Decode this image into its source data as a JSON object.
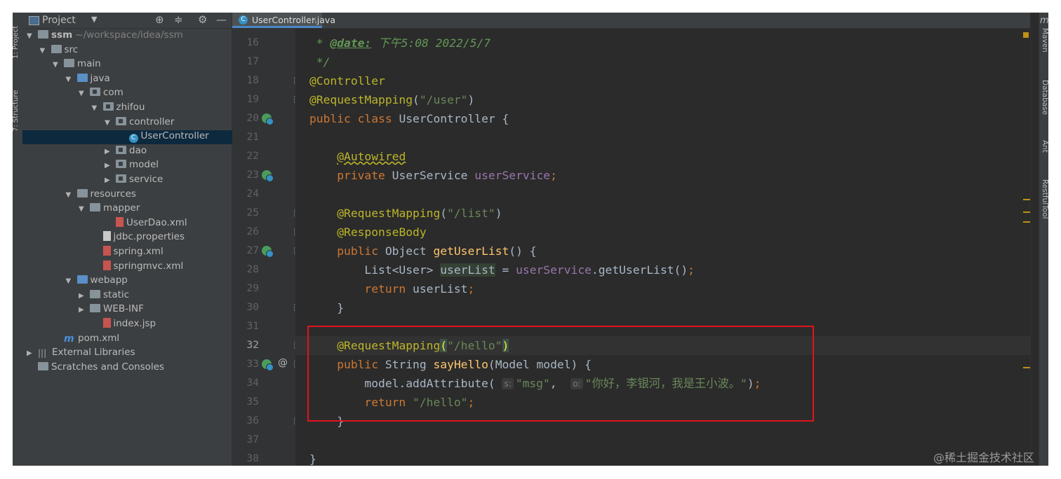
{
  "left_strip": {
    "project_tab": "1: Project",
    "structure_tab": "7: Structure"
  },
  "project_panel": {
    "title": "Project",
    "tree": [
      {
        "label": "ssm",
        "extra": "~/workspace/idea/ssm",
        "icon": "folder",
        "depth": 0,
        "arrow": "▼",
        "bold": true
      },
      {
        "label": "src",
        "icon": "folder",
        "depth": 1,
        "arrow": "▼"
      },
      {
        "label": "main",
        "icon": "folder",
        "depth": 2,
        "arrow": "▼"
      },
      {
        "label": "java",
        "icon": "folder-blue",
        "depth": 3,
        "arrow": "▼"
      },
      {
        "label": "com",
        "icon": "package",
        "depth": 4,
        "arrow": "▼"
      },
      {
        "label": "zhifou",
        "icon": "package",
        "depth": 5,
        "arrow": "▼"
      },
      {
        "label": "controller",
        "icon": "package",
        "depth": 6,
        "arrow": "▼"
      },
      {
        "label": "UserController",
        "icon": "java-class",
        "depth": 7,
        "arrow": "",
        "selected": true
      },
      {
        "label": "dao",
        "icon": "package",
        "depth": 6,
        "arrow": "▶"
      },
      {
        "label": "model",
        "icon": "package",
        "depth": 6,
        "arrow": "▶"
      },
      {
        "label": "service",
        "icon": "package",
        "depth": 6,
        "arrow": "▶"
      },
      {
        "label": "resources",
        "icon": "folder",
        "depth": 3,
        "arrow": "▼"
      },
      {
        "label": "mapper",
        "icon": "folder",
        "depth": 4,
        "arrow": "▼"
      },
      {
        "label": "UserDao.xml",
        "icon": "xml-file",
        "depth": 6,
        "arrow": ""
      },
      {
        "label": "jdbc.properties",
        "icon": "file",
        "depth": 5,
        "arrow": ""
      },
      {
        "label": "spring.xml",
        "icon": "xml-file",
        "depth": 5,
        "arrow": ""
      },
      {
        "label": "springmvc.xml",
        "icon": "xml-file",
        "depth": 5,
        "arrow": ""
      },
      {
        "label": "webapp",
        "icon": "folder-web",
        "depth": 3,
        "arrow": "▼"
      },
      {
        "label": "static",
        "icon": "folder",
        "depth": 4,
        "arrow": "▶"
      },
      {
        "label": "WEB-INF",
        "icon": "folder",
        "depth": 4,
        "arrow": "▶"
      },
      {
        "label": "index.jsp",
        "icon": "jsp-file",
        "depth": 5,
        "arrow": ""
      },
      {
        "label": "pom.xml",
        "icon": "maven-file",
        "depth": 2,
        "arrow": ""
      },
      {
        "label": "External Libraries",
        "icon": "library",
        "depth": 0,
        "arrow": "▶"
      },
      {
        "label": "Scratches and Consoles",
        "icon": "scratch",
        "depth": 0,
        "arrow": ""
      }
    ]
  },
  "editor": {
    "tab": {
      "label": "UserController.java",
      "close": "×"
    },
    "lines": [
      {
        "n": "16",
        "segs": [
          [
            "doc",
            " * "
          ],
          [
            "doctag",
            "@date:"
          ],
          [
            "doc",
            " 下午5:08 2022/5/7"
          ]
        ]
      },
      {
        "n": "17",
        "segs": [
          [
            "doc",
            " */"
          ]
        ]
      },
      {
        "n": "18",
        "segs": [
          [
            "an",
            "@Controller"
          ]
        ]
      },
      {
        "n": "19",
        "segs": [
          [
            "an",
            "@RequestMapping"
          ],
          [
            "",
            "("
          ],
          [
            "str",
            "\"/user\""
          ],
          [
            "",
            ")"
          ]
        ]
      },
      {
        "n": "20",
        "segs": [
          [
            "kw",
            "public class "
          ],
          [
            "",
            "UserController {"
          ]
        ]
      },
      {
        "n": "21",
        "segs": []
      },
      {
        "n": "22",
        "segs": [
          [
            "",
            "    "
          ],
          [
            "an warn",
            "@Autowired"
          ]
        ]
      },
      {
        "n": "23",
        "segs": [
          [
            "",
            "    "
          ],
          [
            "kw",
            "private "
          ],
          [
            "",
            "UserService "
          ],
          [
            "fld",
            "userService"
          ],
          [
            "kw",
            ";"
          ]
        ]
      },
      {
        "n": "24",
        "segs": []
      },
      {
        "n": "25",
        "segs": [
          [
            "",
            "    "
          ],
          [
            "an",
            "@RequestMapping"
          ],
          [
            "",
            "("
          ],
          [
            "str",
            "\"/list\""
          ],
          [
            "",
            ")"
          ]
        ]
      },
      {
        "n": "26",
        "segs": [
          [
            "",
            "    "
          ],
          [
            "an",
            "@ResponseBody"
          ]
        ]
      },
      {
        "n": "27",
        "segs": [
          [
            "",
            "    "
          ],
          [
            "kw",
            "public "
          ],
          [
            "",
            "Object "
          ],
          [
            "fn",
            "getUserList"
          ],
          [
            "",
            "() {"
          ]
        ]
      },
      {
        "n": "28",
        "segs": [
          [
            "",
            "        List<User> "
          ],
          [
            "hl",
            "userList"
          ],
          [
            "",
            " = "
          ],
          [
            "fld",
            "userService"
          ],
          [
            "",
            ".getUserList()"
          ],
          [
            "kw",
            ";"
          ]
        ]
      },
      {
        "n": "29",
        "segs": [
          [
            "",
            "        "
          ],
          [
            "kw",
            "return "
          ],
          [
            "",
            "userList"
          ],
          [
            "kw",
            ";"
          ]
        ]
      },
      {
        "n": "30",
        "segs": [
          [
            "",
            "    }"
          ]
        ]
      },
      {
        "n": "31",
        "segs": []
      },
      {
        "n": "32",
        "segs": [
          [
            "",
            "    "
          ],
          [
            "an",
            "@RequestMapping"
          ],
          [
            "brk",
            "("
          ],
          [
            "str",
            "\"/hello\""
          ],
          [
            "brk",
            ")"
          ]
        ],
        "current": true
      },
      {
        "n": "33",
        "segs": [
          [
            "",
            "    "
          ],
          [
            "kw",
            "public "
          ],
          [
            "",
            "String "
          ],
          [
            "fn",
            "sayHello"
          ],
          [
            "",
            "(Model model) {"
          ]
        ]
      },
      {
        "n": "34",
        "segs": [
          [
            "",
            "        model.addAttribute( "
          ],
          [
            "hint",
            "s:"
          ],
          [
            "str",
            "\"msg\""
          ],
          [
            "",
            ",  "
          ],
          [
            "hint",
            "o:"
          ],
          [
            "str",
            "\"你好，李银河，我是王小波。\""
          ],
          [
            "",
            ")"
          ],
          [
            "kw",
            ";"
          ]
        ]
      },
      {
        "n": "35",
        "segs": [
          [
            "",
            "        "
          ],
          [
            "kw",
            "return "
          ],
          [
            "str",
            "\"/hello\""
          ],
          [
            "kw",
            ";"
          ]
        ]
      },
      {
        "n": "36",
        "segs": [
          [
            "",
            "    }"
          ]
        ]
      },
      {
        "n": "37",
        "segs": []
      },
      {
        "n": "38",
        "segs": [
          [
            "",
            "}"
          ]
        ]
      }
    ],
    "gutter_icons": {
      "20": "bean",
      "23": "bean",
      "27": "bean",
      "33": "bean"
    },
    "gutter_at_line": "33",
    "at_symbol": "@"
  },
  "right_strip": {
    "tabs": [
      "Maven",
      "Database",
      "Ant",
      "RestfulTool"
    ],
    "maven_glyph": "m"
  },
  "watermark": "@稀土掘金技术社区",
  "colors": {
    "keyword": "#cc7832",
    "annotation": "#bbb529",
    "string": "#6a8759",
    "field": "#9876aa",
    "method": "#ffc66d",
    "highlight_box": "#e0141e"
  }
}
